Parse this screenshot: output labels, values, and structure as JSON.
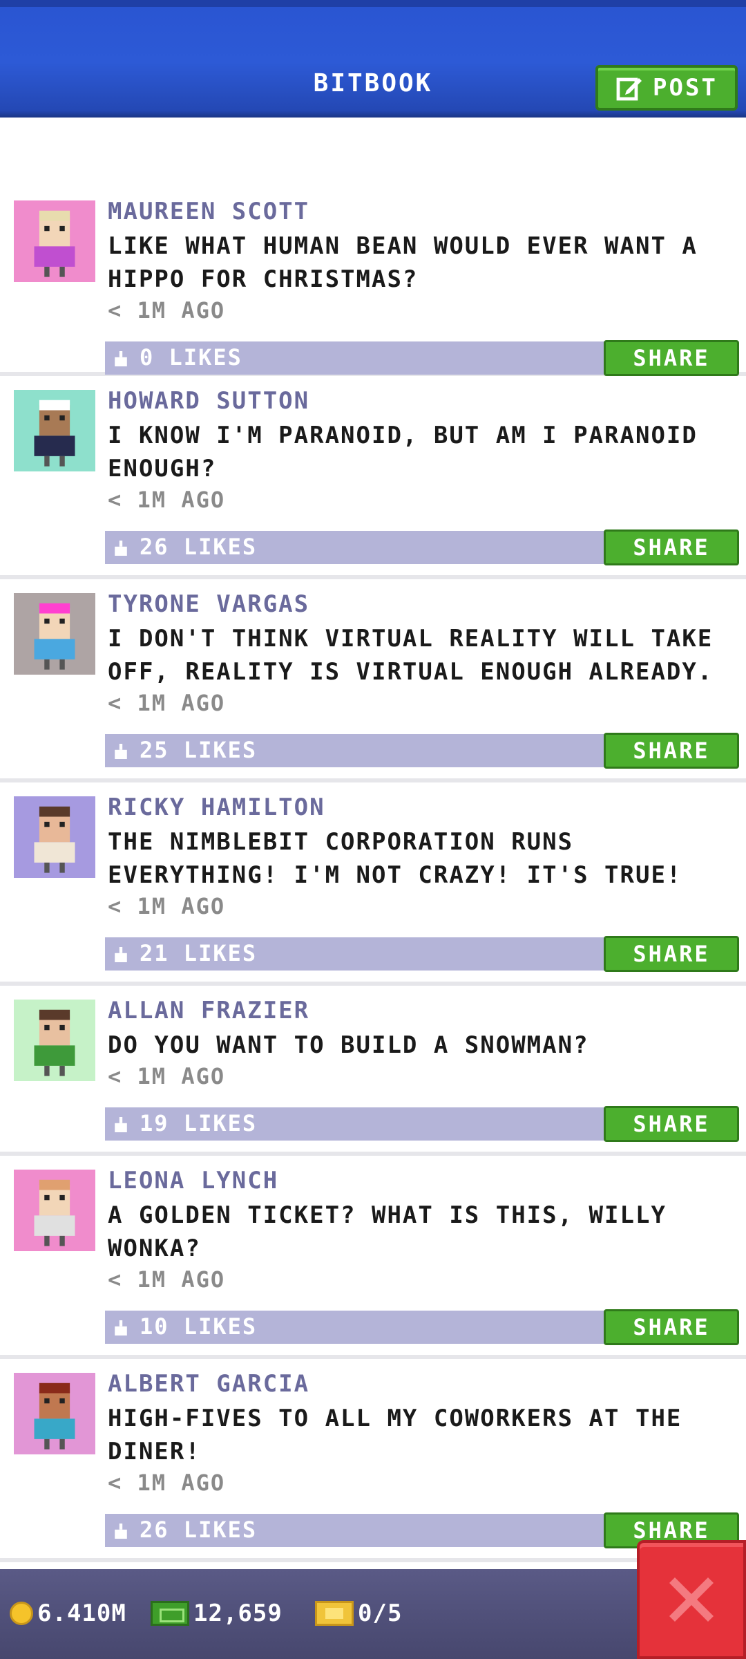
{
  "header": {
    "title": "BITBOOK",
    "post_label": "POST"
  },
  "posts": [
    {
      "author": "MAUREEN SCOTT",
      "message": "LIKE WHAT HUMAN BEAN WOULD EVER WANT A HIPPO FOR CHRISTMAS?",
      "time": "< 1M AGO",
      "likes": "0 LIKES",
      "share": "SHARE",
      "avatar_bg": "#f08ccc",
      "shirt": "#c04fd0",
      "hair": "#e8dcae",
      "skin": "#f2d6b8"
    },
    {
      "author": "HOWARD SUTTON",
      "message": "I KNOW I'M PARANOID, BUT AM I PARANOID ENOUGH?",
      "time": "< 1M AGO",
      "likes": "26 LIKES",
      "share": "SHARE",
      "avatar_bg": "#8ee0cc",
      "shirt": "#262b4e",
      "hair": "#ffffff",
      "skin": "#a87a55"
    },
    {
      "author": "TYRONE VARGAS",
      "message": "I DON'T THINK VIRTUAL REALITY WILL TAKE OFF, REALITY IS VIRTUAL ENOUGH ALREADY.",
      "time": "< 1M AGO",
      "likes": "25 LIKES",
      "share": "SHARE",
      "avatar_bg": "#aea4a4",
      "shirt": "#4aa8e0",
      "hair": "#ff40d0",
      "skin": "#f2d6b8"
    },
    {
      "author": "RICKY HAMILTON",
      "message": "THE NIMBLEBIT CORPORATION RUNS EVERYTHING! I'M NOT CRAZY! IT'S TRUE!",
      "time": "< 1M AGO",
      "likes": "21 LIKES",
      "share": "SHARE",
      "avatar_bg": "#a69ae0",
      "shirt": "#f0e6d6",
      "hair": "#5a3a2a",
      "skin": "#e8b898"
    },
    {
      "author": "ALLAN FRAZIER",
      "message": "DO YOU WANT TO BUILD A SNOWMAN?",
      "time": "< 1M AGO",
      "likes": "19 LIKES",
      "share": "SHARE",
      "avatar_bg": "#c6f2c8",
      "shirt": "#3e9a3a",
      "hair": "#5a3a2a",
      "skin": "#e8c0a0"
    },
    {
      "author": "LEONA LYNCH",
      "message": "A GOLDEN TICKET? WHAT IS THIS, WILLY WONKA?",
      "time": "< 1M AGO",
      "likes": "10 LIKES",
      "share": "SHARE",
      "avatar_bg": "#f08ccc",
      "shirt": "#e0e0e0",
      "hair": "#e0a070",
      "skin": "#f2d6b8"
    },
    {
      "author": "ALBERT GARCIA",
      "message": "HIGH-FIVES TO ALL MY COWORKERS AT THE DINER!",
      "time": "< 1M AGO",
      "likes": "26 LIKES",
      "share": "SHARE",
      "avatar_bg": "#e296d6",
      "shirt": "#38a8c8",
      "hair": "#8a2a1a",
      "skin": "#c07850"
    }
  ],
  "footer": {
    "coins": "6.410M",
    "bux": "12,659",
    "tickets": "0/5"
  },
  "colors": {
    "accent_green": "#4caf2e",
    "header_blue": "#2a55d2",
    "close_red": "#e5323a",
    "likes_bar": "#b4b4d8"
  }
}
